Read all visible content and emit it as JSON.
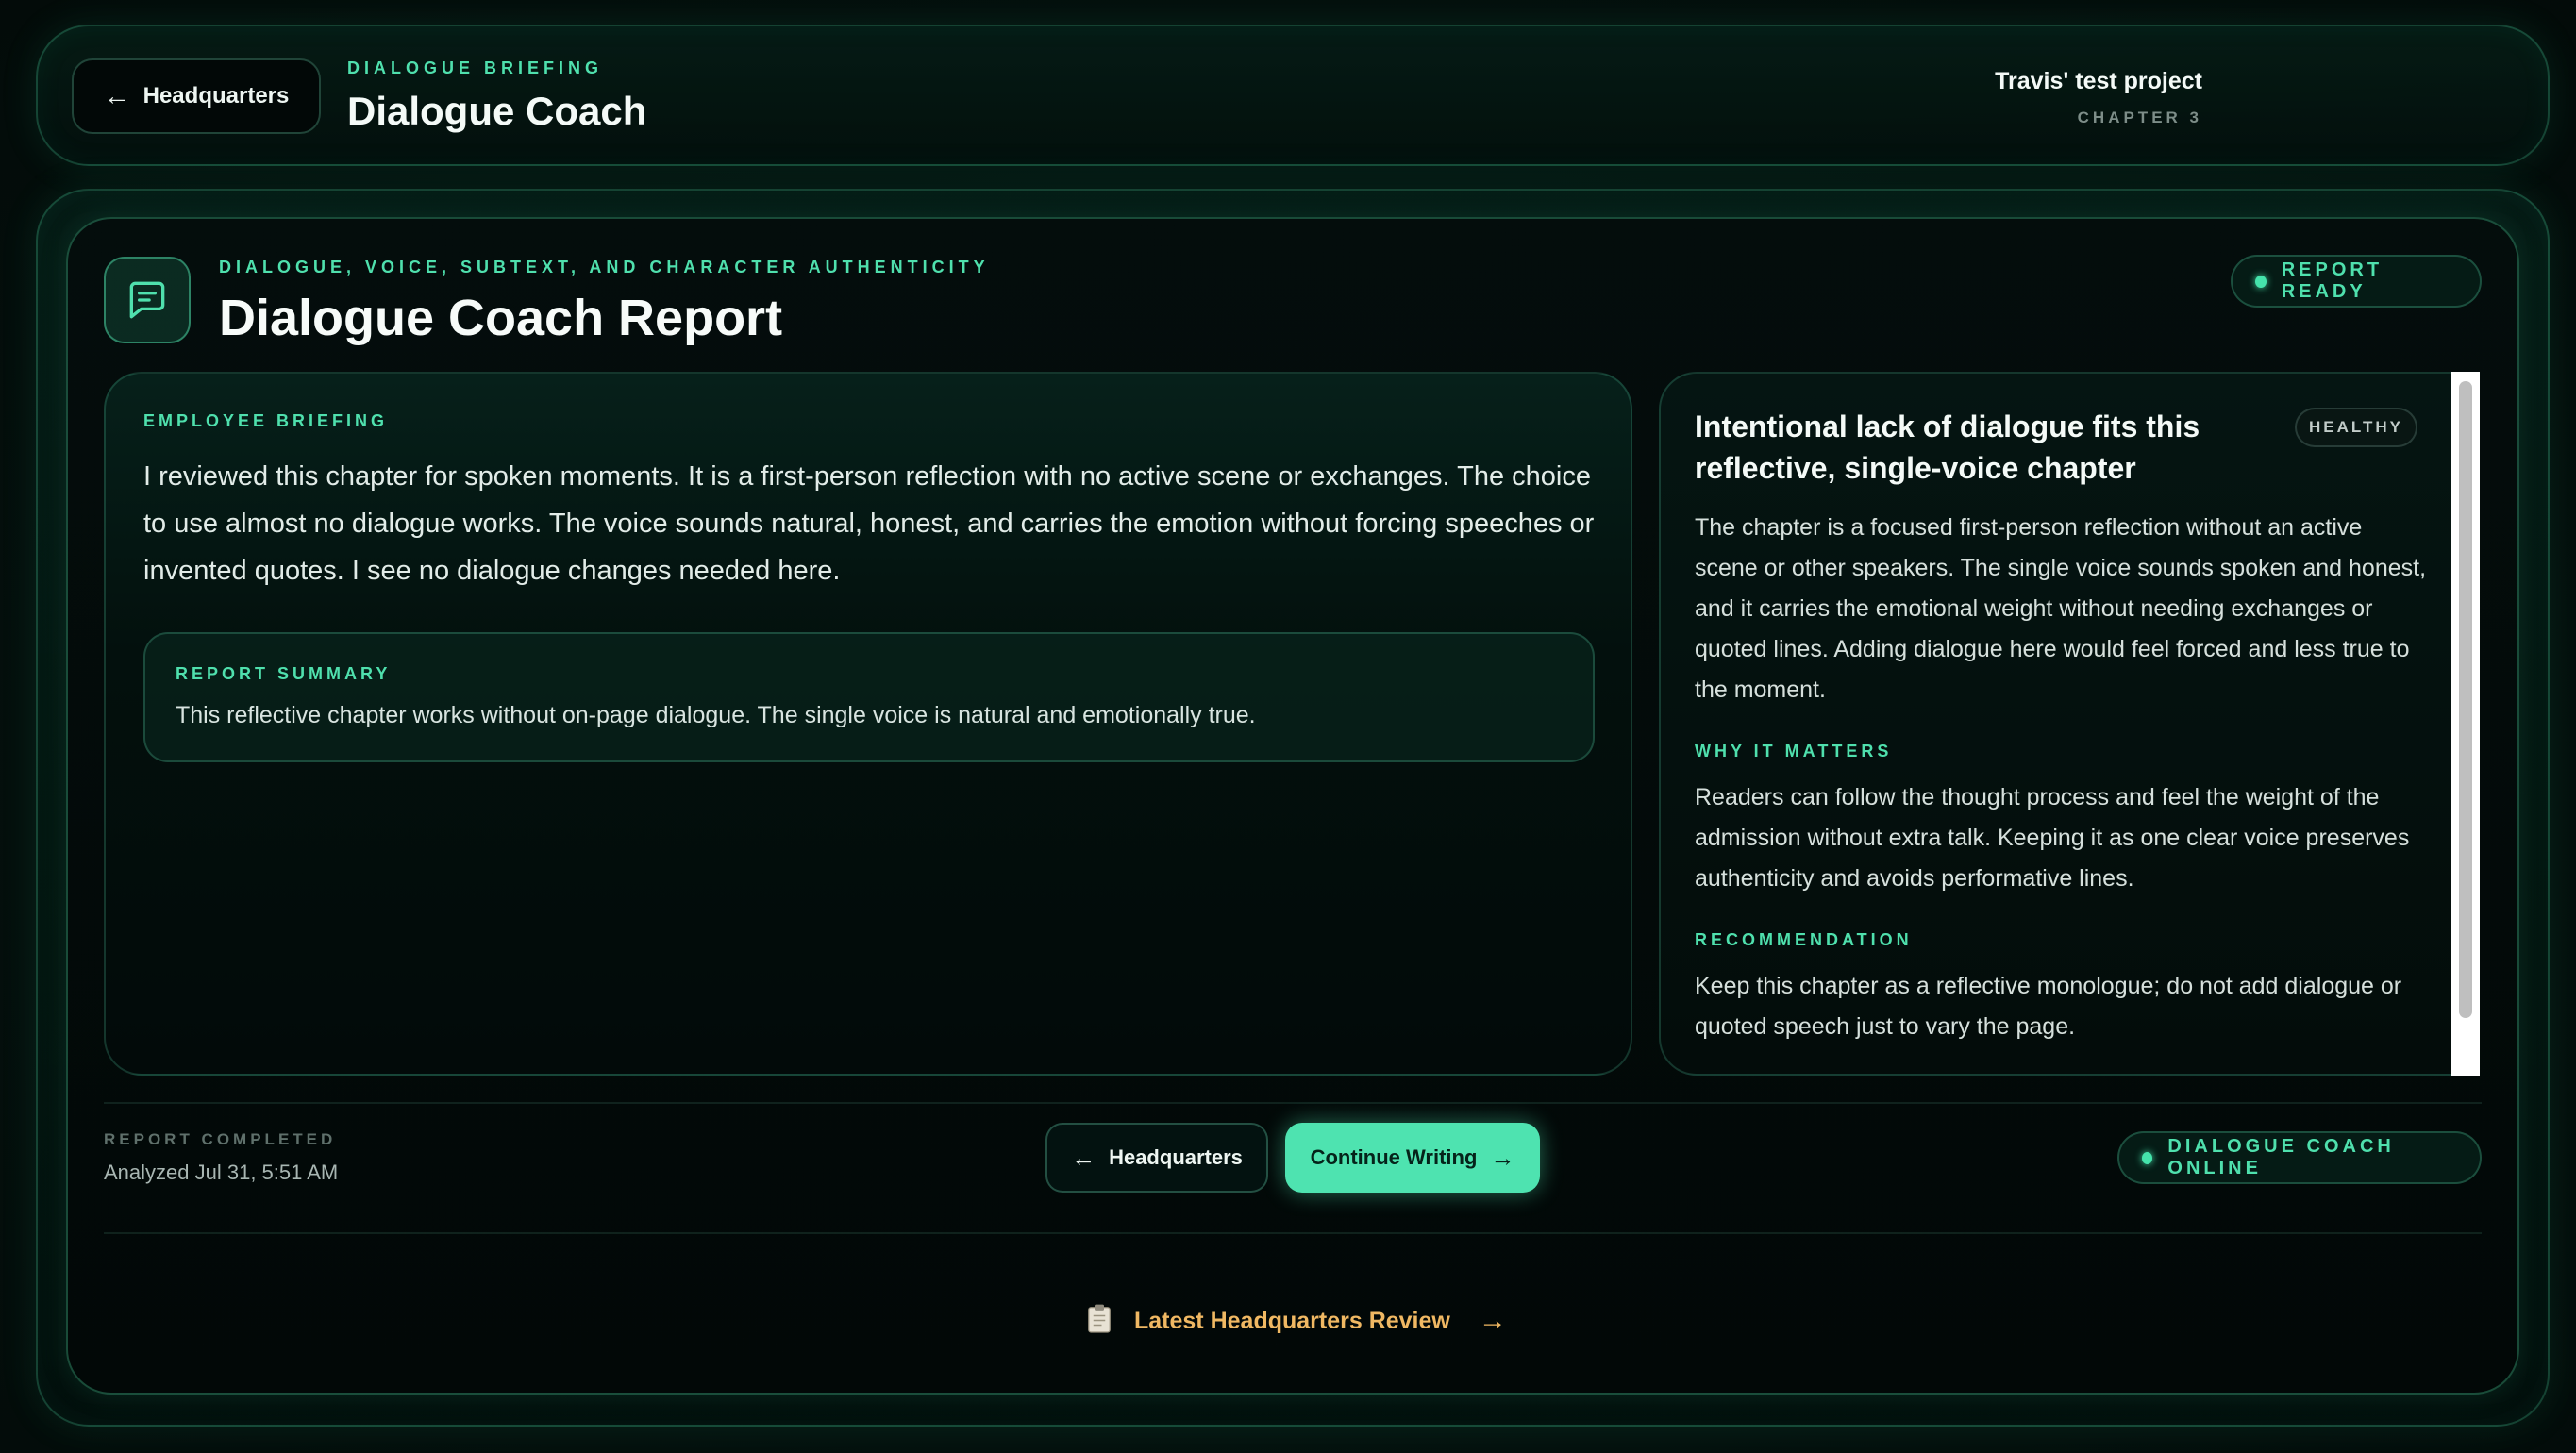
{
  "header": {
    "back_label": "Headquarters",
    "eyebrow": "DIALOGUE BRIEFING",
    "title": "Dialogue Coach",
    "project_name": "Travis' test project",
    "chapter": "CHAPTER 3"
  },
  "report": {
    "icon": "message-square-icon",
    "eyebrow": "DIALOGUE, VOICE, SUBTEXT, AND CHARACTER AUTHENTICITY",
    "title": "Dialogue Coach Report",
    "status": "REPORT READY"
  },
  "briefing": {
    "label": "EMPLOYEE BRIEFING",
    "text": "I reviewed this chapter for spoken moments. It is a first-person reflection with no active scene or exchanges. The choice to use almost no dialogue works. The voice sounds natural, honest, and carries the emotion without forcing speeches or invented quotes. I see no dialogue changes needed here.",
    "summary_label": "REPORT SUMMARY",
    "summary_text": "This reflective chapter works without on-page dialogue. The single voice is natural and emotionally true."
  },
  "finding": {
    "heading": "Intentional lack of dialogue fits this reflective, single-voice chapter",
    "badge": "HEALTHY",
    "description": "The chapter is a focused first-person reflection without an active scene or other speakers. The single voice sounds spoken and honest, and it carries the emotional weight without needing exchanges or quoted lines. Adding dialogue here would feel forced and less true to the moment.",
    "why_label": "WHY IT MATTERS",
    "why_text": "Readers can follow the thought process and feel the weight of the admission without extra talk. Keeping it as one clear voice preserves authenticity and avoids performative lines.",
    "rec_label": "RECOMMENDATION",
    "rec_text": "Keep this chapter as a reflective monologue; do not add dialogue or quoted speech just to vary the page."
  },
  "footer": {
    "completed_label": "REPORT COMPLETED",
    "completed_value": "Analyzed Jul 31, 5:51 AM",
    "hq_button": "Headquarters",
    "continue_button": "Continue Writing",
    "online_status": "DIALOGUE COACH ONLINE",
    "latest_link": "Latest Headquarters Review",
    "latest_icon": "clipboard-icon"
  },
  "colors": {
    "accent": "#4fe0ad",
    "primary_button": "#4ee3b0",
    "link": "#f0b863",
    "background": "#051310"
  }
}
